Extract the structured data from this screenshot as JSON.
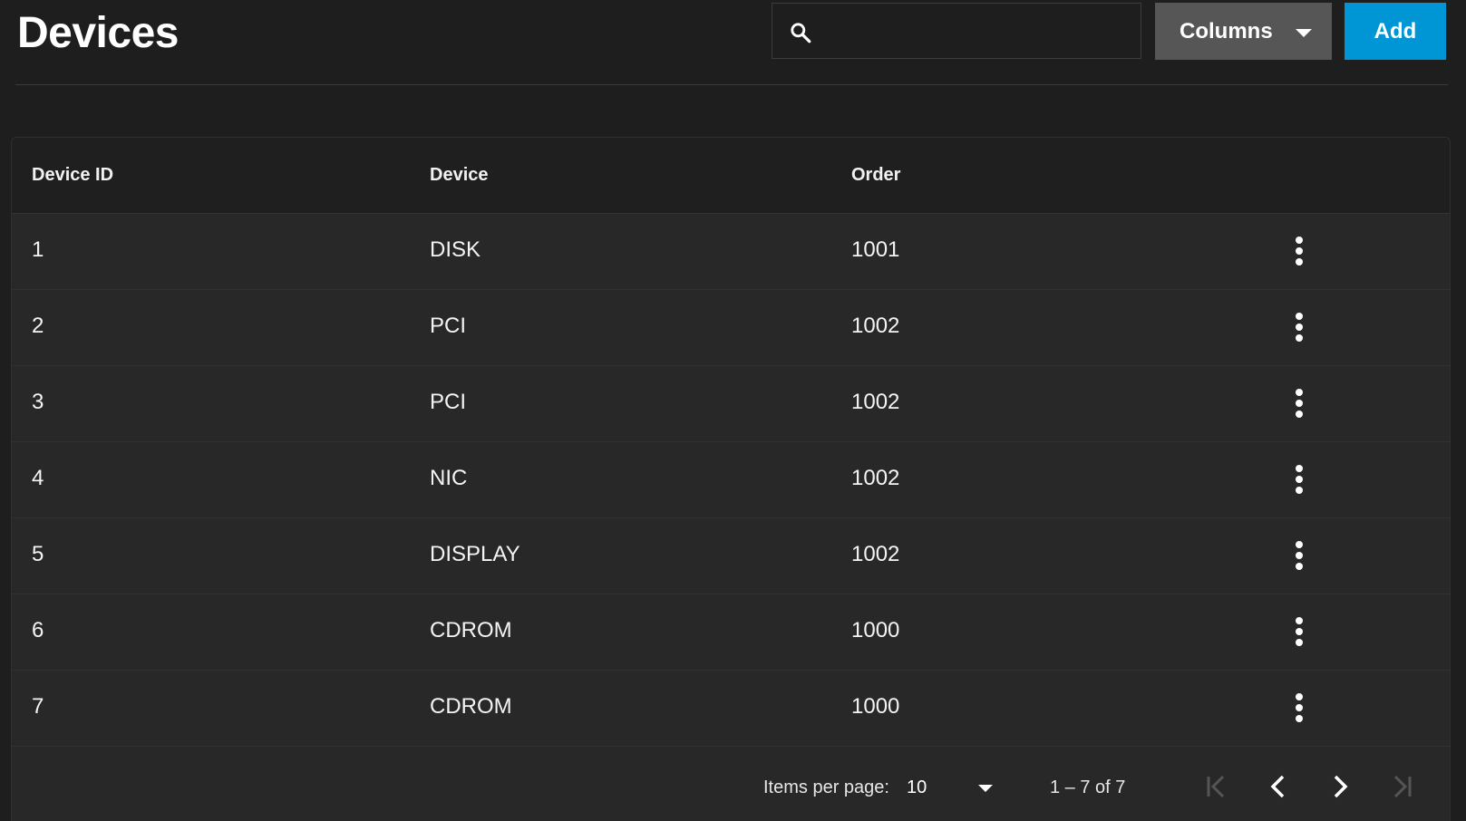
{
  "header": {
    "title": "Devices",
    "search": {
      "value": "",
      "placeholder": ""
    },
    "columns_label": "Columns",
    "add_label": "Add"
  },
  "table": {
    "columns": [
      "Device ID",
      "Device",
      "Order"
    ],
    "rows": [
      {
        "id": "1",
        "device": "DISK",
        "order": "1001"
      },
      {
        "id": "2",
        "device": "PCI",
        "order": "1002"
      },
      {
        "id": "3",
        "device": "PCI",
        "order": "1002"
      },
      {
        "id": "4",
        "device": "NIC",
        "order": "1002"
      },
      {
        "id": "5",
        "device": "DISPLAY",
        "order": "1002"
      },
      {
        "id": "6",
        "device": "CDROM",
        "order": "1000"
      },
      {
        "id": "7",
        "device": "CDROM",
        "order": "1000"
      }
    ]
  },
  "paginator": {
    "items_per_page_label": "Items per page:",
    "page_size": "10",
    "range": "1 – 7 of 7"
  },
  "icons": {
    "search": "search-icon",
    "row_menu": "more-vert-icon",
    "first": "first-page-icon",
    "prev": "chevron-left-icon",
    "next": "chevron-right-icon",
    "last": "last-page-icon"
  },
  "colors": {
    "background": "#1e1e1e",
    "card": "#282828",
    "primary": "#0095d5",
    "secondary_button": "#565656"
  }
}
